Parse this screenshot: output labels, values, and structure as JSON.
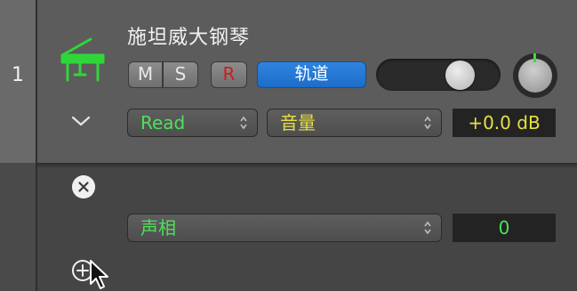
{
  "track": {
    "number": "1",
    "name": "施坦威大钢琴",
    "instrument_icon": "grand-piano-icon"
  },
  "buttons": {
    "mute": "M",
    "solo": "S",
    "record": "R",
    "track_label": "轨道"
  },
  "automation": {
    "mode": "Read",
    "parameter": "音量",
    "value": "+0.0 dB"
  },
  "lane": {
    "parameter": "声相",
    "value": "0"
  },
  "icons": {
    "collapse": "chevron-down-icon",
    "remove_lane": "close-icon",
    "add_lane": "plus-circle-icon",
    "pointer": "mouse-cursor-icon"
  },
  "colors": {
    "green": "#4fe05a",
    "yellow": "#e6e043",
    "blue": "#1d6dc9",
    "record_red": "#d21b1b"
  }
}
